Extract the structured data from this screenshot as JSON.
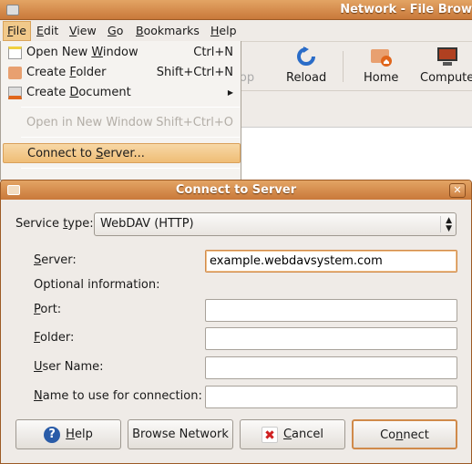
{
  "window": {
    "title": "Network - File Brow"
  },
  "menubar": [
    {
      "label": "File",
      "m": "F"
    },
    {
      "label": "Edit",
      "m": "E"
    },
    {
      "label": "View",
      "m": "V"
    },
    {
      "label": "Go",
      "m": "G"
    },
    {
      "label": "Bookmarks",
      "m": "B"
    },
    {
      "label": "Help",
      "m": "H"
    }
  ],
  "toolbar": {
    "stop": "op",
    "reload": "Reload",
    "home": "Home",
    "computer": "Compute"
  },
  "file_menu": {
    "open_new_window": {
      "label": "Open New Window",
      "m": "W",
      "shortcut": "Ctrl+N"
    },
    "create_folder": {
      "label": "Create Folder",
      "m": "F",
      "shortcut": "Shift+Ctrl+N"
    },
    "create_document": {
      "label": "Create Document",
      "m": "D"
    },
    "open_in_new_window": {
      "label": "Open in New Window",
      "shortcut": "Shift+Ctrl+O"
    },
    "connect_to_server": {
      "label": "Connect to Server...",
      "m": "S"
    }
  },
  "dialog": {
    "title": "Connect to Server",
    "service_type_label": "Service type:",
    "service_type_m": "t",
    "service_type_value": "WebDAV (HTTP)",
    "server_label": "Server:",
    "server_value": "example.webdavsystem.com",
    "optional_label": "Optional information:",
    "port_label": "Port:",
    "port_value": "",
    "folder_label": "Folder:",
    "folder_value": "",
    "username_label": "User Name:",
    "username_value": "",
    "connname_label": "Name to use for connection:",
    "connname_value": "",
    "buttons": {
      "help": "Help",
      "browse": "Browse Network",
      "cancel": "Cancel",
      "connect": "Connect"
    }
  },
  "colors": {
    "accent": "#d08a4a",
    "titlebar": "#c9793a",
    "highlight": "#efbd76"
  }
}
